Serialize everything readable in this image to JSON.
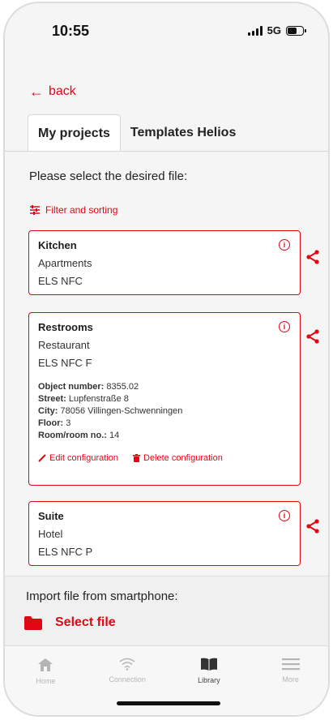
{
  "status_bar": {
    "time": "10:55",
    "network": "5G"
  },
  "nav_back": {
    "label": "back"
  },
  "tabs": [
    {
      "label": "My projects",
      "active": true
    },
    {
      "label": "Templates Helios",
      "active": false
    }
  ],
  "prompt": "Please select the desired file:",
  "filter": {
    "label": "Filter and sorting"
  },
  "cards": [
    {
      "title": "Kitchen",
      "subtitle": "Apartments",
      "type": "ELS NFC"
    },
    {
      "title": "Restrooms",
      "subtitle": "Restaurant",
      "type": "ELS NFC F",
      "details": [
        {
          "label": "Object number:",
          "value": "8355.02"
        },
        {
          "label": "Street:",
          "value": "Lupfenstraße 8"
        },
        {
          "label": "City:",
          "value": "78056 Villingen-Schwenningen"
        },
        {
          "label": "Floor:",
          "value": "3"
        },
        {
          "label": "Room/room no.:",
          "value": "14"
        }
      ],
      "actions": {
        "edit": "Edit configuration",
        "delete": "Delete configuration"
      }
    },
    {
      "title": "Suite",
      "subtitle": "Hotel",
      "type": "ELS NFC P"
    }
  ],
  "import": {
    "label": "Import file from smartphone:",
    "select_label": "Select file"
  },
  "bottom_nav": [
    {
      "label": "Home",
      "icon": "home-icon",
      "active": false
    },
    {
      "label": "Connection",
      "icon": "wifi-icon",
      "active": false
    },
    {
      "label": "Library",
      "icon": "book-icon",
      "active": true
    },
    {
      "label": "More",
      "icon": "menu-icon",
      "active": false
    }
  ],
  "colors": {
    "accent": "#e30613",
    "inactive": "#b5b5b5"
  }
}
